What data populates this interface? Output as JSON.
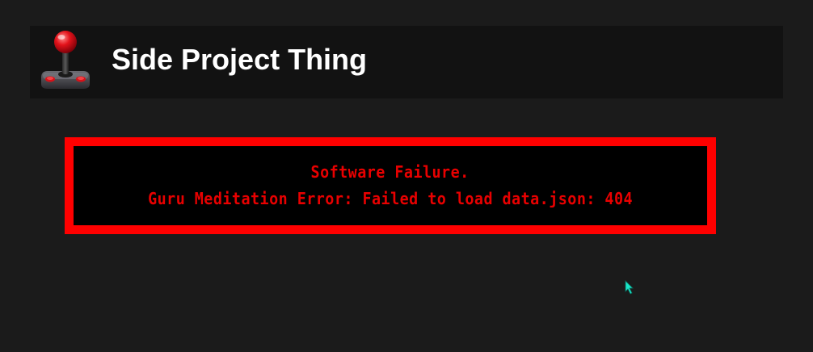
{
  "header": {
    "logo_icon": "joystick-icon",
    "title": "Side Project Thing"
  },
  "error": {
    "line1": "Software Failure.",
    "line2": "Guru Meditation Error: Failed to load data.json: 404",
    "border_color": "#ff0000",
    "text_color": "#e80000"
  },
  "cursor": {
    "icon": "mouse-pointer-icon",
    "color": "#19e6c8"
  }
}
